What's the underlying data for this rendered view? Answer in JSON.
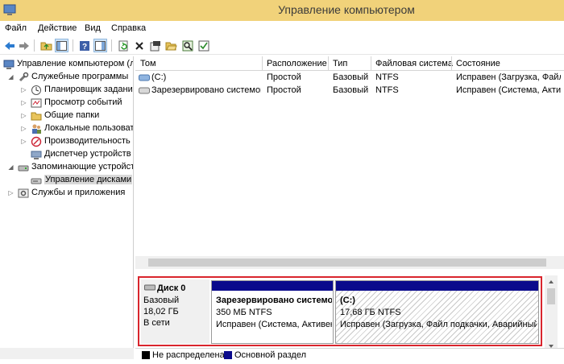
{
  "window": {
    "title": "Управление компьютером"
  },
  "menu": [
    "Файл",
    "Действие",
    "Вид",
    "Справка"
  ],
  "toolbar": [
    "back-arrow-icon",
    "forward-arrow-icon",
    "up-folder-icon",
    "show-hide-tree-icon",
    "help-icon",
    "console-view-icon",
    "refresh-icon",
    "delete-icon",
    "properties-icon",
    "open-folder-icon",
    "search-icon",
    "check-list-icon"
  ],
  "tree": [
    {
      "label": "Управление компьютером (л",
      "icon": "computer-management-icon",
      "level": 0,
      "arrow": ""
    },
    {
      "label": "Служебные программы",
      "icon": "tools-icon",
      "level": 1,
      "arrow": "◢"
    },
    {
      "label": "Планировщик заданий",
      "icon": "clock-icon",
      "level": 2,
      "arrow": "▷"
    },
    {
      "label": "Просмотр событий",
      "icon": "event-viewer-icon",
      "level": 2,
      "arrow": "▷"
    },
    {
      "label": "Общие папки",
      "icon": "shared-folder-icon",
      "level": 2,
      "arrow": "▷"
    },
    {
      "label": "Локальные пользовате",
      "icon": "users-icon",
      "level": 2,
      "arrow": "▷"
    },
    {
      "label": "Производительность",
      "icon": "performance-icon",
      "level": 2,
      "arrow": "▷"
    },
    {
      "label": "Диспетчер устройств",
      "icon": "device-manager-icon",
      "level": 2,
      "arrow": ""
    },
    {
      "label": "Запоминающие устройст",
      "icon": "storage-icon",
      "level": 1,
      "arrow": "◢"
    },
    {
      "label": "Управление дисками",
      "icon": "disk-management-icon",
      "level": 2,
      "arrow": "",
      "selected": true
    },
    {
      "label": "Службы и приложения",
      "icon": "services-icon",
      "level": 1,
      "arrow": "▷"
    }
  ],
  "columns": [
    "Том",
    "Расположение",
    "Тип",
    "Файловая система",
    "Состояние"
  ],
  "volumes": [
    {
      "name": "(C:)",
      "layout": "Простой",
      "type": "Базовый",
      "fs": "NTFS",
      "status": "Исправен (Загрузка, Файл",
      "selected": true
    },
    {
      "name": "Зарезервировано системой",
      "layout": "Простой",
      "type": "Базовый",
      "fs": "NTFS",
      "status": "Исправен (Система, Актив"
    }
  ],
  "disk": {
    "name": "Диск 0",
    "type": "Базовый",
    "size": "18,02 ГБ",
    "state": "В сети"
  },
  "partitions": [
    {
      "name": "Зарезервировано системой",
      "size": "350 МБ NTFS",
      "status": "Исправен (Система, Активен"
    },
    {
      "name": "(C:)",
      "size": "17,68 ГБ NTFS",
      "status": "Исправен (Загрузка, Файл подкачки, Аварийный д"
    }
  ],
  "legend": [
    {
      "label": "Не распределена",
      "color": "#000000"
    },
    {
      "label": "Основной раздел",
      "color": "#0a0a8c"
    }
  ],
  "colors": {
    "titlebar": "#f1d27a",
    "primary_partition": "#0a0a8c",
    "highlight": "#d9252d"
  }
}
